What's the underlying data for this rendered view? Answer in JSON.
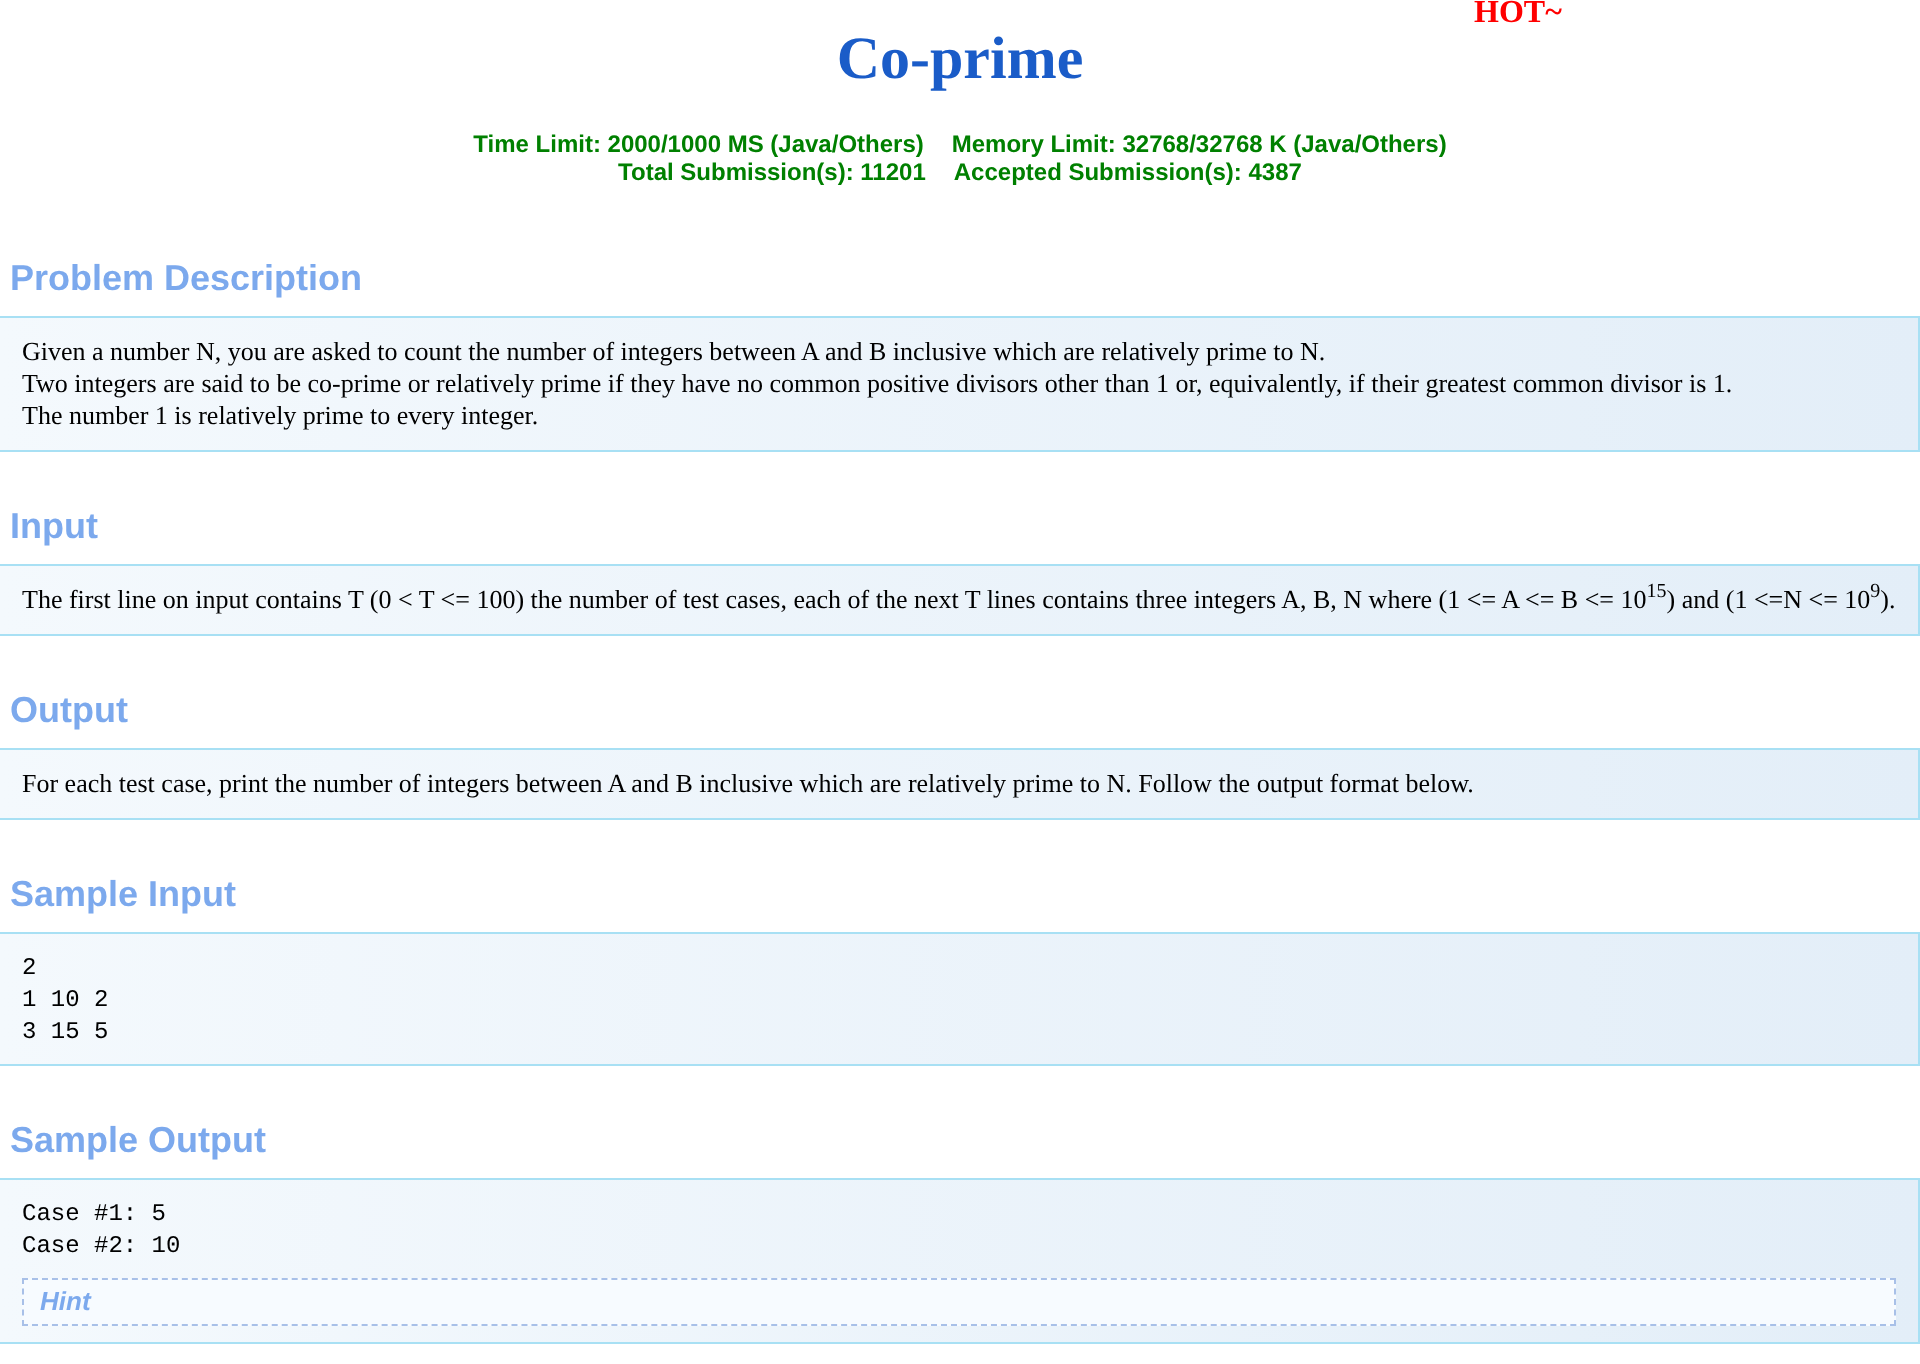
{
  "header": {
    "hot": "HOT~",
    "title": "Co-prime",
    "limits": [
      [
        "Time Limit: 2000/1000 MS (Java/Others)",
        "Memory Limit: 32768/32768 K (Java/Others)"
      ],
      [
        "Total Submission(s): 11201",
        "Accepted Submission(s): 4387"
      ]
    ]
  },
  "sections": [
    {
      "heading": "Problem Description",
      "kind": "text",
      "lines": [
        "Given a number N, you are asked to count the number of integers between A and B inclusive which are relatively prime to N.",
        "Two integers are said to be co-prime or relatively prime if they have no common positive divisors other than 1 or, equivalently, if their greatest common divisor is 1.",
        "The number 1 is relatively prime to every integer."
      ]
    },
    {
      "heading": "Input",
      "kind": "text",
      "lines": [
        "The first line on input contains T (0 < T <= 100) the number of test cases, each of the next T lines contains three integers A, B, N where (1 <= A <= B <= 10$^{15}$) and (1 <=N <= 10$^{9}$)."
      ]
    },
    {
      "heading": "Output",
      "kind": "text",
      "lines": [
        "For each test case, print the number of integers between A and B inclusive which are relatively prime to N. Follow the output format below."
      ]
    },
    {
      "heading": "Sample Input",
      "kind": "code",
      "lines": [
        "2",
        "1 10 2",
        "3 15 5"
      ]
    },
    {
      "heading": "Sample Output",
      "kind": "code",
      "lines": [
        "Case #1: 5",
        "Case #2: 10"
      ],
      "hint": "Hint"
    }
  ]
}
